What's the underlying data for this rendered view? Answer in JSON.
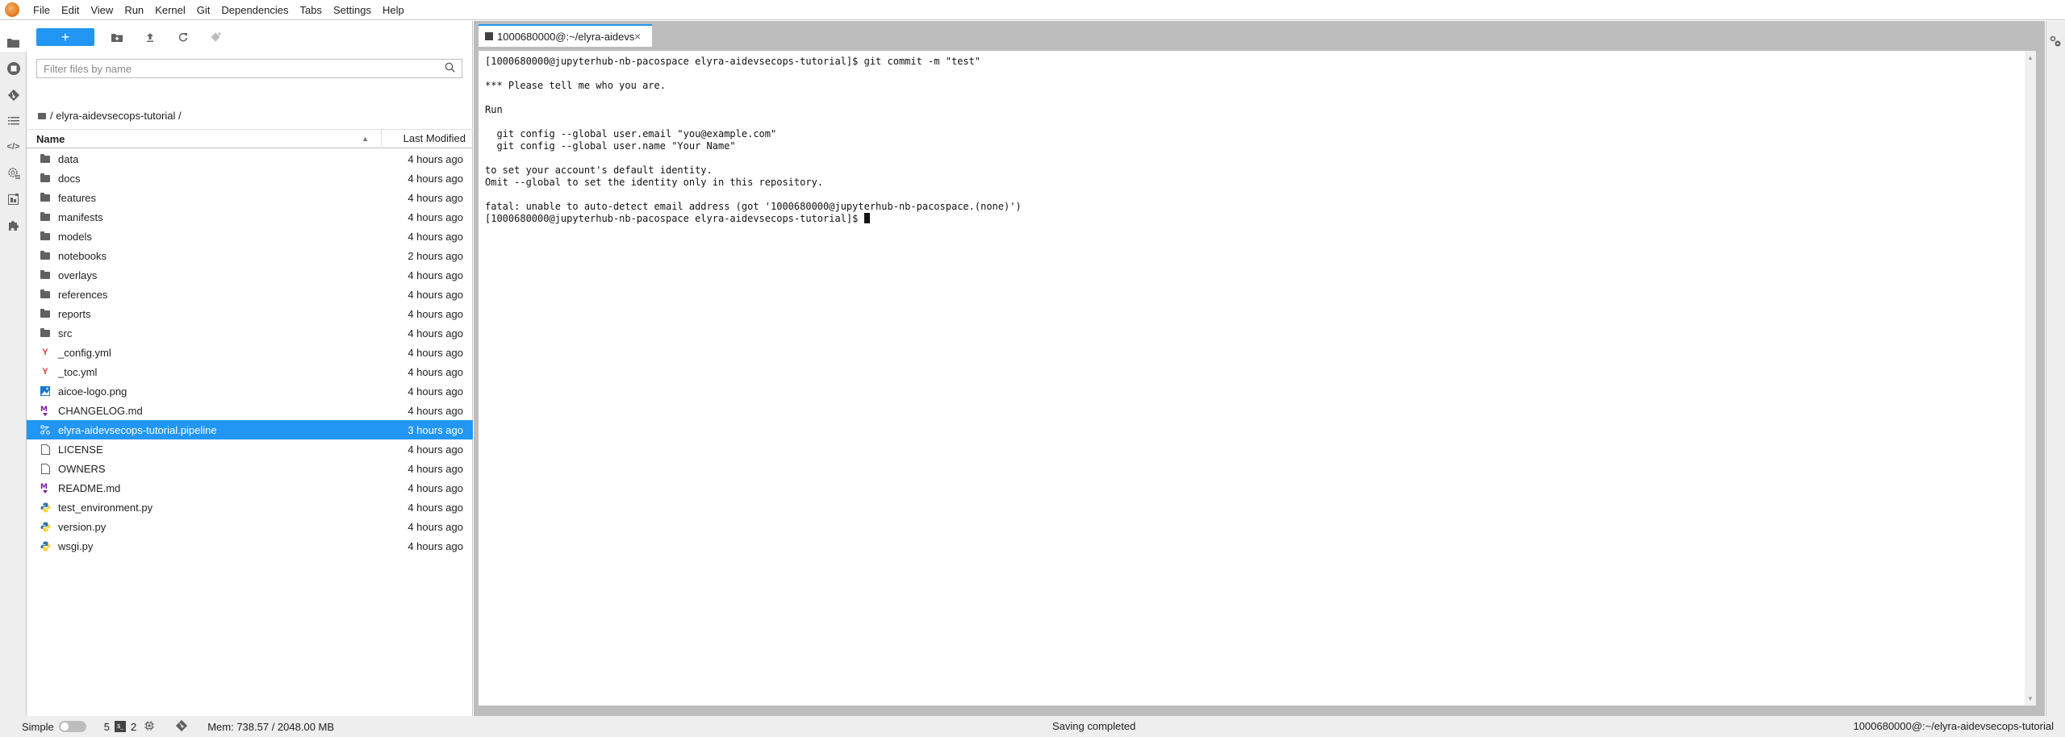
{
  "menubar": {
    "items": [
      "File",
      "Edit",
      "View",
      "Run",
      "Kernel",
      "Git",
      "Dependencies",
      "Tabs",
      "Settings",
      "Help"
    ]
  },
  "leftbar": {
    "icons": [
      "folder-icon",
      "running-stop-icon",
      "git-icon",
      "toc-icon",
      "code-snippets-icon",
      "runtimes-icon",
      "component-catalog-icon",
      "extensions-icon"
    ]
  },
  "filebrowser": {
    "new_label": "+",
    "filter_placeholder": "Filter files by name",
    "breadcrumb": "/ elyra-aidevsecops-tutorial /",
    "columns": {
      "name": "Name",
      "modified": "Last Modified"
    },
    "files": [
      {
        "name": "data",
        "type": "folder",
        "modified": "4 hours ago"
      },
      {
        "name": "docs",
        "type": "folder",
        "modified": "4 hours ago"
      },
      {
        "name": "features",
        "type": "folder",
        "modified": "4 hours ago"
      },
      {
        "name": "manifests",
        "type": "folder",
        "modified": "4 hours ago"
      },
      {
        "name": "models",
        "type": "folder",
        "modified": "4 hours ago"
      },
      {
        "name": "notebooks",
        "type": "folder",
        "modified": "2 hours ago"
      },
      {
        "name": "overlays",
        "type": "folder",
        "modified": "4 hours ago"
      },
      {
        "name": "references",
        "type": "folder",
        "modified": "4 hours ago"
      },
      {
        "name": "reports",
        "type": "folder",
        "modified": "4 hours ago"
      },
      {
        "name": "src",
        "type": "folder",
        "modified": "4 hours ago"
      },
      {
        "name": "_config.yml",
        "type": "yaml",
        "modified": "4 hours ago"
      },
      {
        "name": "_toc.yml",
        "type": "yaml",
        "modified": "4 hours ago"
      },
      {
        "name": "aicoe-logo.png",
        "type": "image",
        "modified": "4 hours ago"
      },
      {
        "name": "CHANGELOG.md",
        "type": "markdown",
        "modified": "4 hours ago"
      },
      {
        "name": "elyra-aidevsecops-tutorial.pipeline",
        "type": "pipeline",
        "modified": "3 hours ago",
        "selected": true
      },
      {
        "name": "LICENSE",
        "type": "file",
        "modified": "4 hours ago"
      },
      {
        "name": "OWNERS",
        "type": "file",
        "modified": "4 hours ago"
      },
      {
        "name": "README.md",
        "type": "markdown",
        "modified": "4 hours ago"
      },
      {
        "name": "test_environment.py",
        "type": "python",
        "modified": "4 hours ago"
      },
      {
        "name": "version.py",
        "type": "python",
        "modified": "4 hours ago"
      },
      {
        "name": "wsgi.py",
        "type": "python",
        "modified": "4 hours ago"
      }
    ]
  },
  "tab": {
    "label": "1000680000@:~/elyra-aidevsecops-tutorial",
    "close": "×"
  },
  "terminal": {
    "lines": [
      "[1000680000@jupyterhub-nb-pacospace elyra-aidevsecops-tutorial]$ git commit -m \"test\"",
      "",
      "*** Please tell me who you are.",
      "",
      "Run",
      "",
      "  git config --global user.email \"you@example.com\"",
      "  git config --global user.name \"Your Name\"",
      "",
      "to set your account's default identity.",
      "Omit --global to set the identity only in this repository.",
      "",
      "fatal: unable to auto-detect email address (got '1000680000@jupyterhub-nb-pacospace.(none)')"
    ],
    "prompt": "[1000680000@jupyterhub-nb-pacospace elyra-aidevsecops-tutorial]$ "
  },
  "statusbar": {
    "mode_label": "Simple",
    "kernels_count": "5",
    "terminals_count": "2",
    "memory": "Mem: 738.57 / 2048.00 MB",
    "status": "Saving completed",
    "right": "1000680000@:~/elyra-aidevsecops-tutorial"
  },
  "colors": {
    "accent": "#2196f3",
    "yaml": "#e53935",
    "markdown": "#7b1fa2",
    "image": "#1976d2"
  }
}
